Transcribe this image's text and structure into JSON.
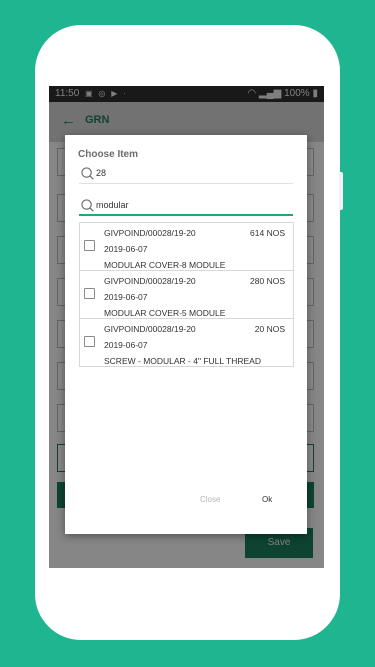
{
  "status_bar": {
    "time": "11:50",
    "battery": "100%"
  },
  "app_bar": {
    "title": "GRN"
  },
  "background": {
    "save_label": "Save"
  },
  "dialog": {
    "title": "Choose Item",
    "search_number": "28",
    "search_text": "modular",
    "items": [
      {
        "code": "GIVPOIND/00028/19-20",
        "qty": "614 NOS",
        "date": "2019-06-07",
        "name": "MODULAR COVER-8 MODULE"
      },
      {
        "code": "GIVPOIND/00028/19-20",
        "qty": "280 NOS",
        "date": "2019-06-07",
        "name": "MODULAR COVER-5 MODULE"
      },
      {
        "code": "GIVPOIND/00028/19-20",
        "qty": "20 NOS",
        "date": "2019-06-07",
        "name": "SCREW - MODULAR - 4\" FULL THREAD"
      }
    ],
    "close_label": "Close",
    "ok_label": "Ok"
  },
  "colors": {
    "background_teal": "#1fb591",
    "accent_green": "#1a7a5c",
    "focus_underline": "#23a583"
  }
}
